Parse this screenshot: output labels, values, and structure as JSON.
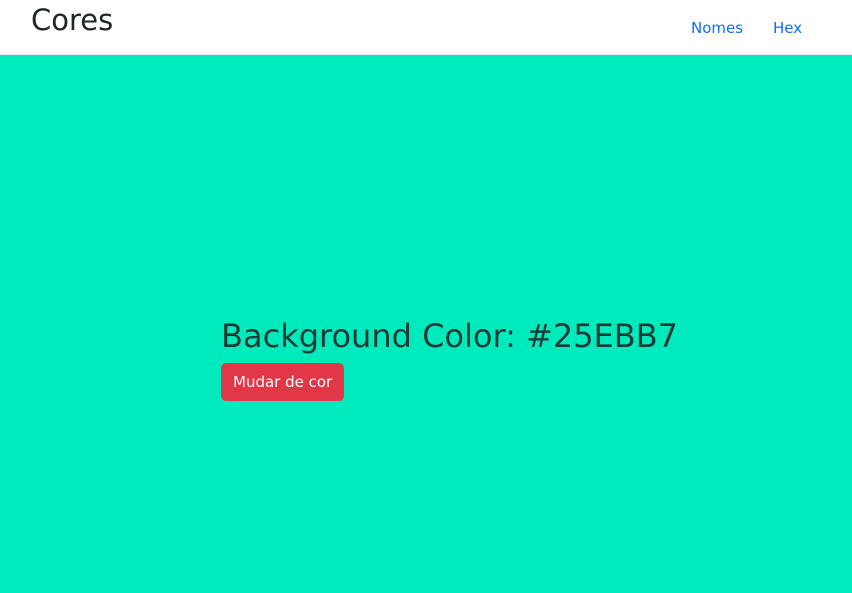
{
  "navbar": {
    "brand": "Cores",
    "links": [
      {
        "label": "Nomes"
      },
      {
        "label": "Hex"
      }
    ]
  },
  "main": {
    "heading_prefix": "Background Color: ",
    "heading_value": "#25EBB7",
    "button_label": "Mudar de cor"
  },
  "colors": {
    "background": "#00ebbd",
    "button": "#e23747",
    "link": "#0d6efd"
  }
}
